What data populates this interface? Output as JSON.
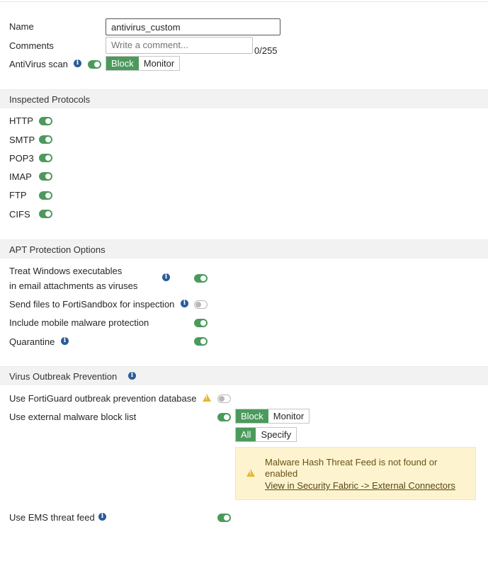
{
  "form": {
    "name_label": "Name",
    "name_value": "antivirus_custom",
    "comments_label": "Comments",
    "comments_placeholder": "Write a comment...",
    "comments_counter": "0/255",
    "antivirus_scan_label": "AntiVirus scan",
    "antivirus_scan_enabled": true,
    "antivirus_mode_options": [
      "Block",
      "Monitor"
    ],
    "antivirus_mode_selected": "Block"
  },
  "inspected_protocols": {
    "title": "Inspected Protocols",
    "items": [
      {
        "label": "HTTP",
        "enabled": true
      },
      {
        "label": "SMTP",
        "enabled": true
      },
      {
        "label": "POP3",
        "enabled": true
      },
      {
        "label": "IMAP",
        "enabled": true
      },
      {
        "label": "FTP",
        "enabled": true
      },
      {
        "label": "CIFS",
        "enabled": true
      }
    ]
  },
  "apt_protection": {
    "title": "APT Protection Options",
    "treat_windows_line1": "Treat Windows executables",
    "treat_windows_line2": "in email attachments as viruses",
    "treat_windows_enabled": true,
    "send_sandbox_label": "Send files to FortiSandbox for inspection",
    "send_sandbox_enabled": false,
    "mobile_malware_label": "Include mobile malware protection",
    "mobile_malware_enabled": true,
    "quarantine_label": "Quarantine",
    "quarantine_enabled": true
  },
  "virus_outbreak": {
    "title": "Virus Outbreak Prevention",
    "fortiguard_label": "Use FortiGuard outbreak prevention database",
    "fortiguard_enabled": false,
    "external_block_label": "Use external malware block list",
    "external_block_enabled": true,
    "external_mode_options": [
      "Block",
      "Monitor"
    ],
    "external_mode_selected": "Block",
    "scope_options": [
      "All",
      "Specify"
    ],
    "scope_selected": "All",
    "warning_message": "Malware Hash Threat Feed is not found or enabled",
    "warning_link": "View in Security Fabric -> External Connectors",
    "ems_label": "Use EMS threat feed",
    "ems_enabled": true
  },
  "colors": {
    "toggle_on": "#4b9a5c",
    "info_icon": "#2b5b9a",
    "warning_icon": "#e8b730",
    "warning_bg": "#fdf4cf",
    "section_bg": "#f2f2f2"
  }
}
